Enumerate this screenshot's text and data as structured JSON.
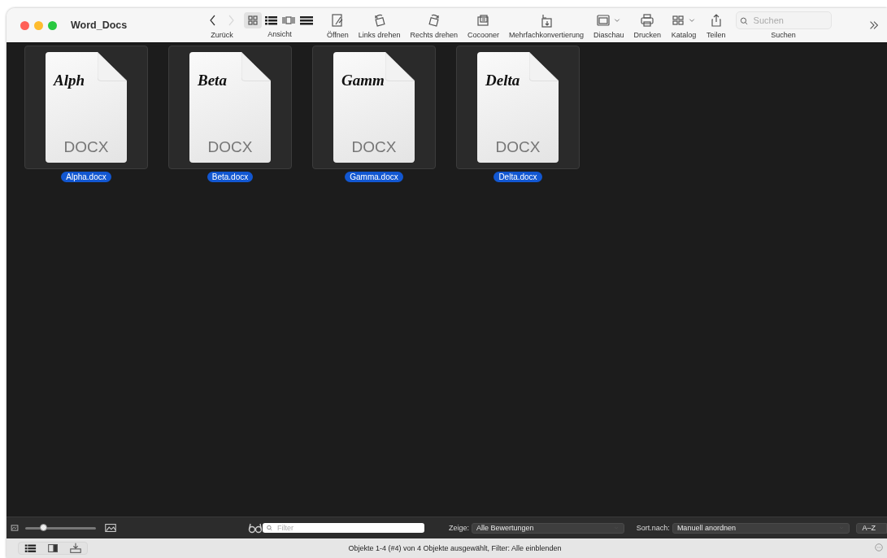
{
  "window": {
    "title": "Word_Docs"
  },
  "toolbar": {
    "nav": {
      "label": "Zurück",
      "buttons": [
        {
          "kind": "back",
          "disabled": false
        },
        {
          "kind": "forward",
          "disabled": true
        }
      ]
    },
    "views": {
      "label": "Ansicht",
      "items": [
        {
          "kind": "grid",
          "selected": true
        },
        {
          "kind": "list",
          "selected": false
        },
        {
          "kind": "strip",
          "selected": false
        },
        {
          "kind": "rows",
          "selected": false
        }
      ]
    },
    "tools": [
      {
        "kind": "open",
        "label": "Öffnen",
        "menu": false
      },
      {
        "kind": "rotate-left",
        "label": "Links drehen",
        "menu": false
      },
      {
        "kind": "rotate-right",
        "label": "Rechts drehen",
        "menu": false
      },
      {
        "kind": "cocoon",
        "label": "Cocooner",
        "menu": false
      },
      {
        "kind": "convert",
        "label": "Mehrfachkonvertierung",
        "menu": false
      },
      {
        "kind": "slideshow",
        "label": "Diaschau",
        "menu": true
      },
      {
        "kind": "print",
        "label": "Drucken",
        "menu": false
      },
      {
        "kind": "catalog",
        "label": "Katalog",
        "menu": true
      },
      {
        "kind": "share",
        "label": "Teilen",
        "menu": false
      }
    ],
    "search": {
      "placeholder": "Suchen",
      "label": "Suchen"
    }
  },
  "files": [
    {
      "preview": "Alph",
      "type": "DOCX",
      "name": "Alpha.docx",
      "selected": true
    },
    {
      "preview": "Beta",
      "type": "DOCX",
      "name": "Beta.docx",
      "selected": true
    },
    {
      "preview": "Gamm",
      "type": "DOCX",
      "name": "Gamma.docx",
      "selected": true
    },
    {
      "preview": "Delta",
      "type": "DOCX",
      "name": "Delta.docx",
      "selected": true
    }
  ],
  "bottom_bar": {
    "zoom": {
      "level": 0.27
    },
    "filter": {
      "placeholder": "Filter"
    },
    "show": {
      "label": "Zeige:",
      "value": "Alle Bewertungen"
    },
    "sort": {
      "label": "Sort.nach:",
      "value": "Manuell anordnen"
    },
    "order_button": "A–Z"
  },
  "status_bar": {
    "views": [
      {
        "kind": "list"
      },
      {
        "kind": "panel"
      },
      {
        "kind": "import"
      }
    ],
    "text": "Objekte 1-4 (#4) von 4 Objekte ausgewählt, Filter: Alle einblenden"
  }
}
